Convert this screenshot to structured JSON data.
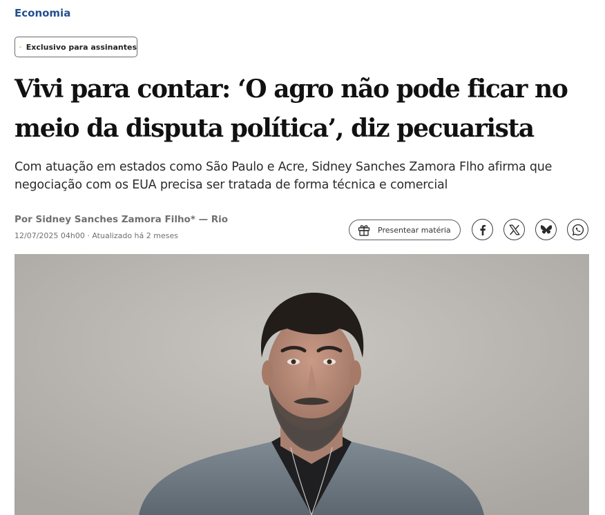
{
  "section": {
    "label": "Economia"
  },
  "badge": {
    "icon": "crown-icon",
    "label": "Exclusivo para assinantes",
    "icon_color": "#e6a42e"
  },
  "headline": {
    "lines": [
      "Vivi para contar: ‘O agro não pode ficar no",
      "meio da disputa política’, diz pecuarista"
    ]
  },
  "subtitle": {
    "lines": [
      "Com atuação em estados como São Paulo e Acre, Sidney Sanches Zamora Flho afirma que",
      "negociação com os EUA precisa ser tratada de forma técnica e comercial"
    ]
  },
  "byline": {
    "text": "Por Sidney Sanches Zamora Filho* — Rio"
  },
  "dateline": {
    "text": "12/07/2025 04h00 · Atualizado há 2 meses"
  },
  "share": {
    "gift_label": "Presentear matéria",
    "gift_icon": "gift-icon",
    "buttons": [
      "facebook-icon",
      "x-icon",
      "bluesky-icon",
      "whatsapp-icon"
    ]
  },
  "colors": {
    "section": "#24508f",
    "text": "#111111",
    "meta": "#6f6f6f"
  },
  "photo": {
    "subject": "portrait-photo"
  }
}
